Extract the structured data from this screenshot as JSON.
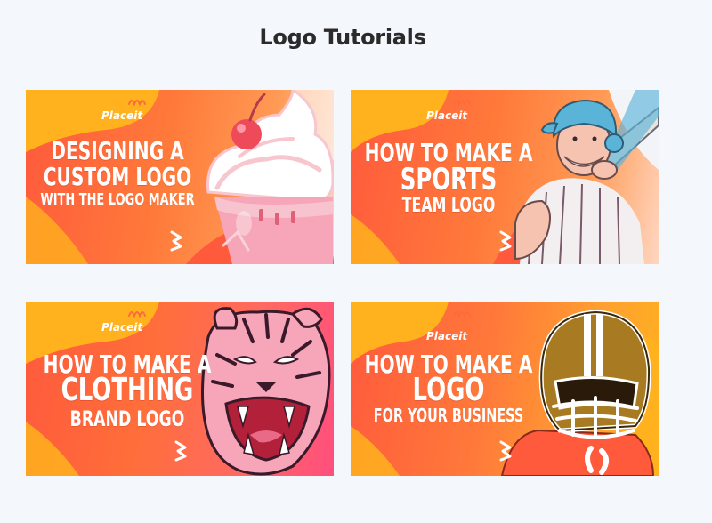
{
  "page": {
    "title": "Logo Tutorials"
  },
  "colors": {
    "background": "#f4f8fc",
    "title": "#2b2b2b",
    "card_orange": "#ff6a3d",
    "card_yellow": "#ffb21e",
    "text_white": "#ffffff"
  },
  "cards": [
    {
      "brand": "Placeit",
      "line1": "DESIGNING A",
      "line2": "CUSTOM LOGO",
      "line3": "WITH THE LOGO MAKER",
      "illustration": "cupcake-icon"
    },
    {
      "brand": "Placeit",
      "line1": "HOW TO MAKE A",
      "line2": "SPORTS",
      "line3": "TEAM LOGO",
      "illustration": "baseball-player-icon"
    },
    {
      "brand": "Placeit",
      "line1": "HOW TO MAKE A",
      "line2": "CLOTHING",
      "line3": "BRAND LOGO",
      "illustration": "tiger-icon"
    },
    {
      "brand": "Placeit",
      "line1": "HOW TO MAKE A",
      "line2": "LOGO",
      "line3": "FOR YOUR BUSINESS",
      "illustration": "football-helmet-icon"
    }
  ]
}
